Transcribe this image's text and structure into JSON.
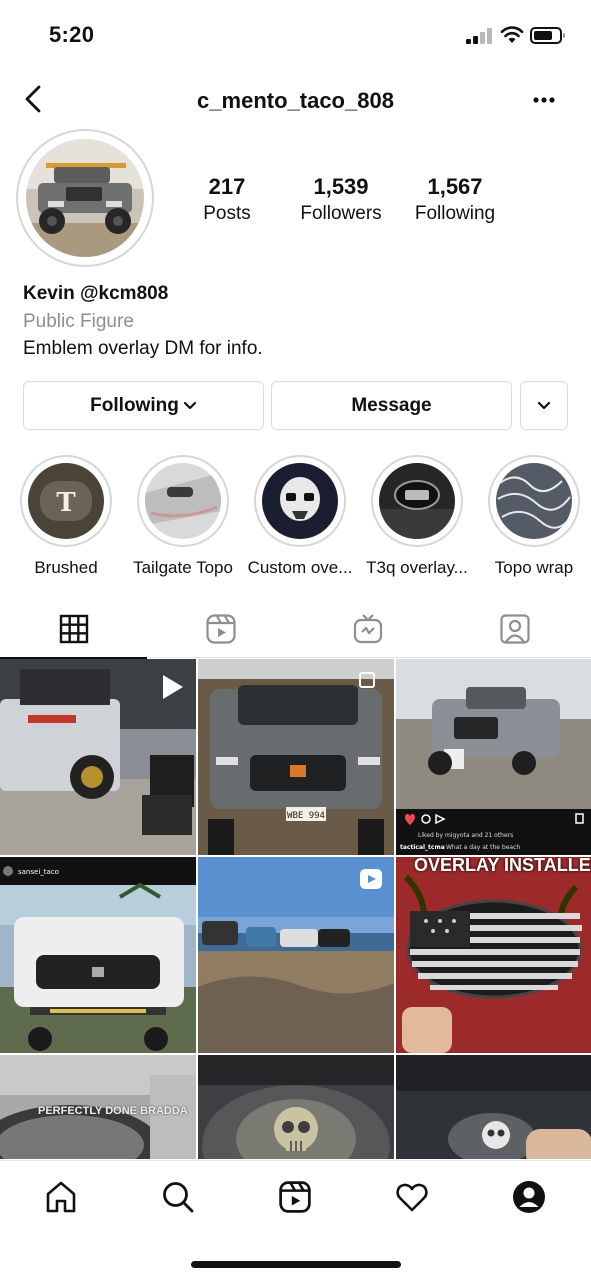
{
  "status_bar": {
    "time": "5:20"
  },
  "header": {
    "username": "c_mento_taco_808"
  },
  "profile": {
    "stats": [
      {
        "value": "217",
        "label": "Posts"
      },
      {
        "value": "1,539",
        "label": "Followers"
      },
      {
        "value": "1,567",
        "label": "Following"
      }
    ],
    "name": "Kevin @kcm808",
    "category": "Public Figure",
    "bio": "Emblem overlay DM for info."
  },
  "actions": {
    "following_label": "Following",
    "message_label": "Message"
  },
  "highlights": [
    {
      "label": "Brushed"
    },
    {
      "label": "Tailgate Topo"
    },
    {
      "label": "Custom ove..."
    },
    {
      "label": "T3q overlay..."
    },
    {
      "label": "Topo wrap"
    }
  ],
  "posts": [
    {
      "overlay_text": ""
    },
    {
      "overlay_text": ""
    },
    {
      "caption_user": "tactical_tcma",
      "caption_text": "What a day at the beach",
      "liked_by": "Liked by migyota and 21 others"
    },
    {
      "poster": "sansei_taco"
    },
    {
      "overlay_text": ""
    },
    {
      "overlay_text": "OVERLAY INSTALLED!!!!"
    },
    {
      "overlay_text": "PERFECTLY DONE BRADDA"
    },
    {
      "overlay_text": ""
    },
    {
      "overlay_text": ""
    }
  ],
  "colors": {
    "accent": "#111111",
    "muted": "#8e8e8e",
    "border": "#dbdbdb",
    "like_red": "#ed4956"
  }
}
